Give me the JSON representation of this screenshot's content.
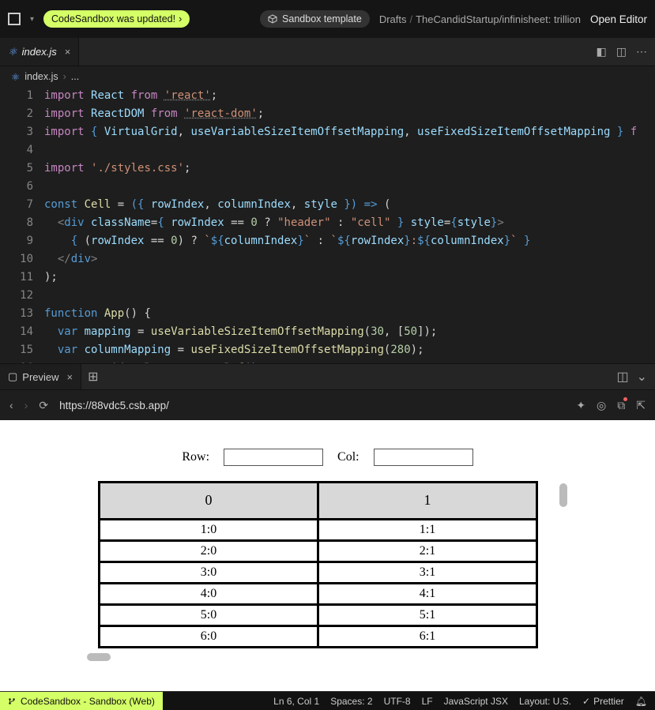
{
  "topbar": {
    "update_pill": "CodeSandbox was updated!",
    "template_label": "Sandbox template",
    "crumb1": "Drafts",
    "crumb2": "TheCandidStartup/infinisheet: trillion",
    "open_editor": "Open Editor"
  },
  "tab": {
    "name": "index.js"
  },
  "breadcrumb": {
    "file": "index.js",
    "more": "..."
  },
  "editor": {
    "lines": [
      "1",
      "2",
      "3",
      "4",
      "5",
      "6",
      "7",
      "8",
      "9",
      "10",
      "11",
      "12",
      "13",
      "14",
      "15",
      "16"
    ]
  },
  "code": {
    "l1": {
      "kw": "import",
      "id": "React",
      "from": "from",
      "str": "'react'"
    },
    "l2": {
      "kw": "import",
      "id": "ReactDOM",
      "from": "from",
      "str": "'react-dom'"
    },
    "l3": {
      "kw": "import",
      "b": "{ ",
      "a": "VirtualGrid",
      "c": ", ",
      "d": "useVariableSizeItemOffsetMapping",
      "e": ", ",
      "f": "useFixedSizeItemOffsetMapping",
      "g": " }",
      "from": "f"
    },
    "l5": {
      "kw": "import",
      "str": "'./styles.css'"
    },
    "l7": {
      "kw": "const",
      "id": "Cell",
      "eq": " = ",
      "p1": "({ ",
      "a": "rowIndex",
      "c1": ", ",
      "b": "columnIndex",
      "c2": ", ",
      "c": "style",
      "p2": " }) ",
      "ar": "=>",
      "p3": " ("
    },
    "l8": {
      "tag": "div",
      "cn": "className",
      "ri": "rowIndex",
      "z": "0",
      "h": "\"header\"",
      "cl": "\"cell\"",
      "st": "style"
    },
    "l9": {
      "ri": "rowIndex",
      "z": "0",
      "ci": "columnIndex"
    },
    "l10": {
      "tag": "div"
    },
    "l11": ");",
    "l13": {
      "kw": "function",
      "id": "App",
      "b": "() {"
    },
    "l14": {
      "kw": "var",
      "id": "mapping",
      "fn": "useVariableSizeItemOffsetMapping",
      "n1": "30",
      "n2": "50"
    },
    "l15": {
      "kw": "var",
      "id": "columnMapping",
      "fn": "useFixedSizeItemOffsetMapping",
      "n": "280"
    },
    "l16": {
      "kw": "const",
      "id": "grid",
      "r": "React",
      "cr": "createRef"
    }
  },
  "panel": {
    "tab": "Preview",
    "url": "https://88vdc5.csb.app/"
  },
  "preview": {
    "row_label": "Row:",
    "col_label": "Col:",
    "headers": [
      "0",
      "1"
    ],
    "cells": [
      [
        "1:0",
        "1:1"
      ],
      [
        "2:0",
        "2:1"
      ],
      [
        "3:0",
        "3:1"
      ],
      [
        "4:0",
        "4:1"
      ],
      [
        "5:0",
        "5:1"
      ],
      [
        "6:0",
        "6:1"
      ]
    ]
  },
  "status": {
    "brand": "CodeSandbox - Sandbox (Web)",
    "pos": "Ln 6, Col 1",
    "spaces": "Spaces: 2",
    "enc": "UTF-8",
    "eol": "LF",
    "lang": "JavaScript JSX",
    "layout": "Layout: U.S.",
    "prettier": "Prettier"
  }
}
